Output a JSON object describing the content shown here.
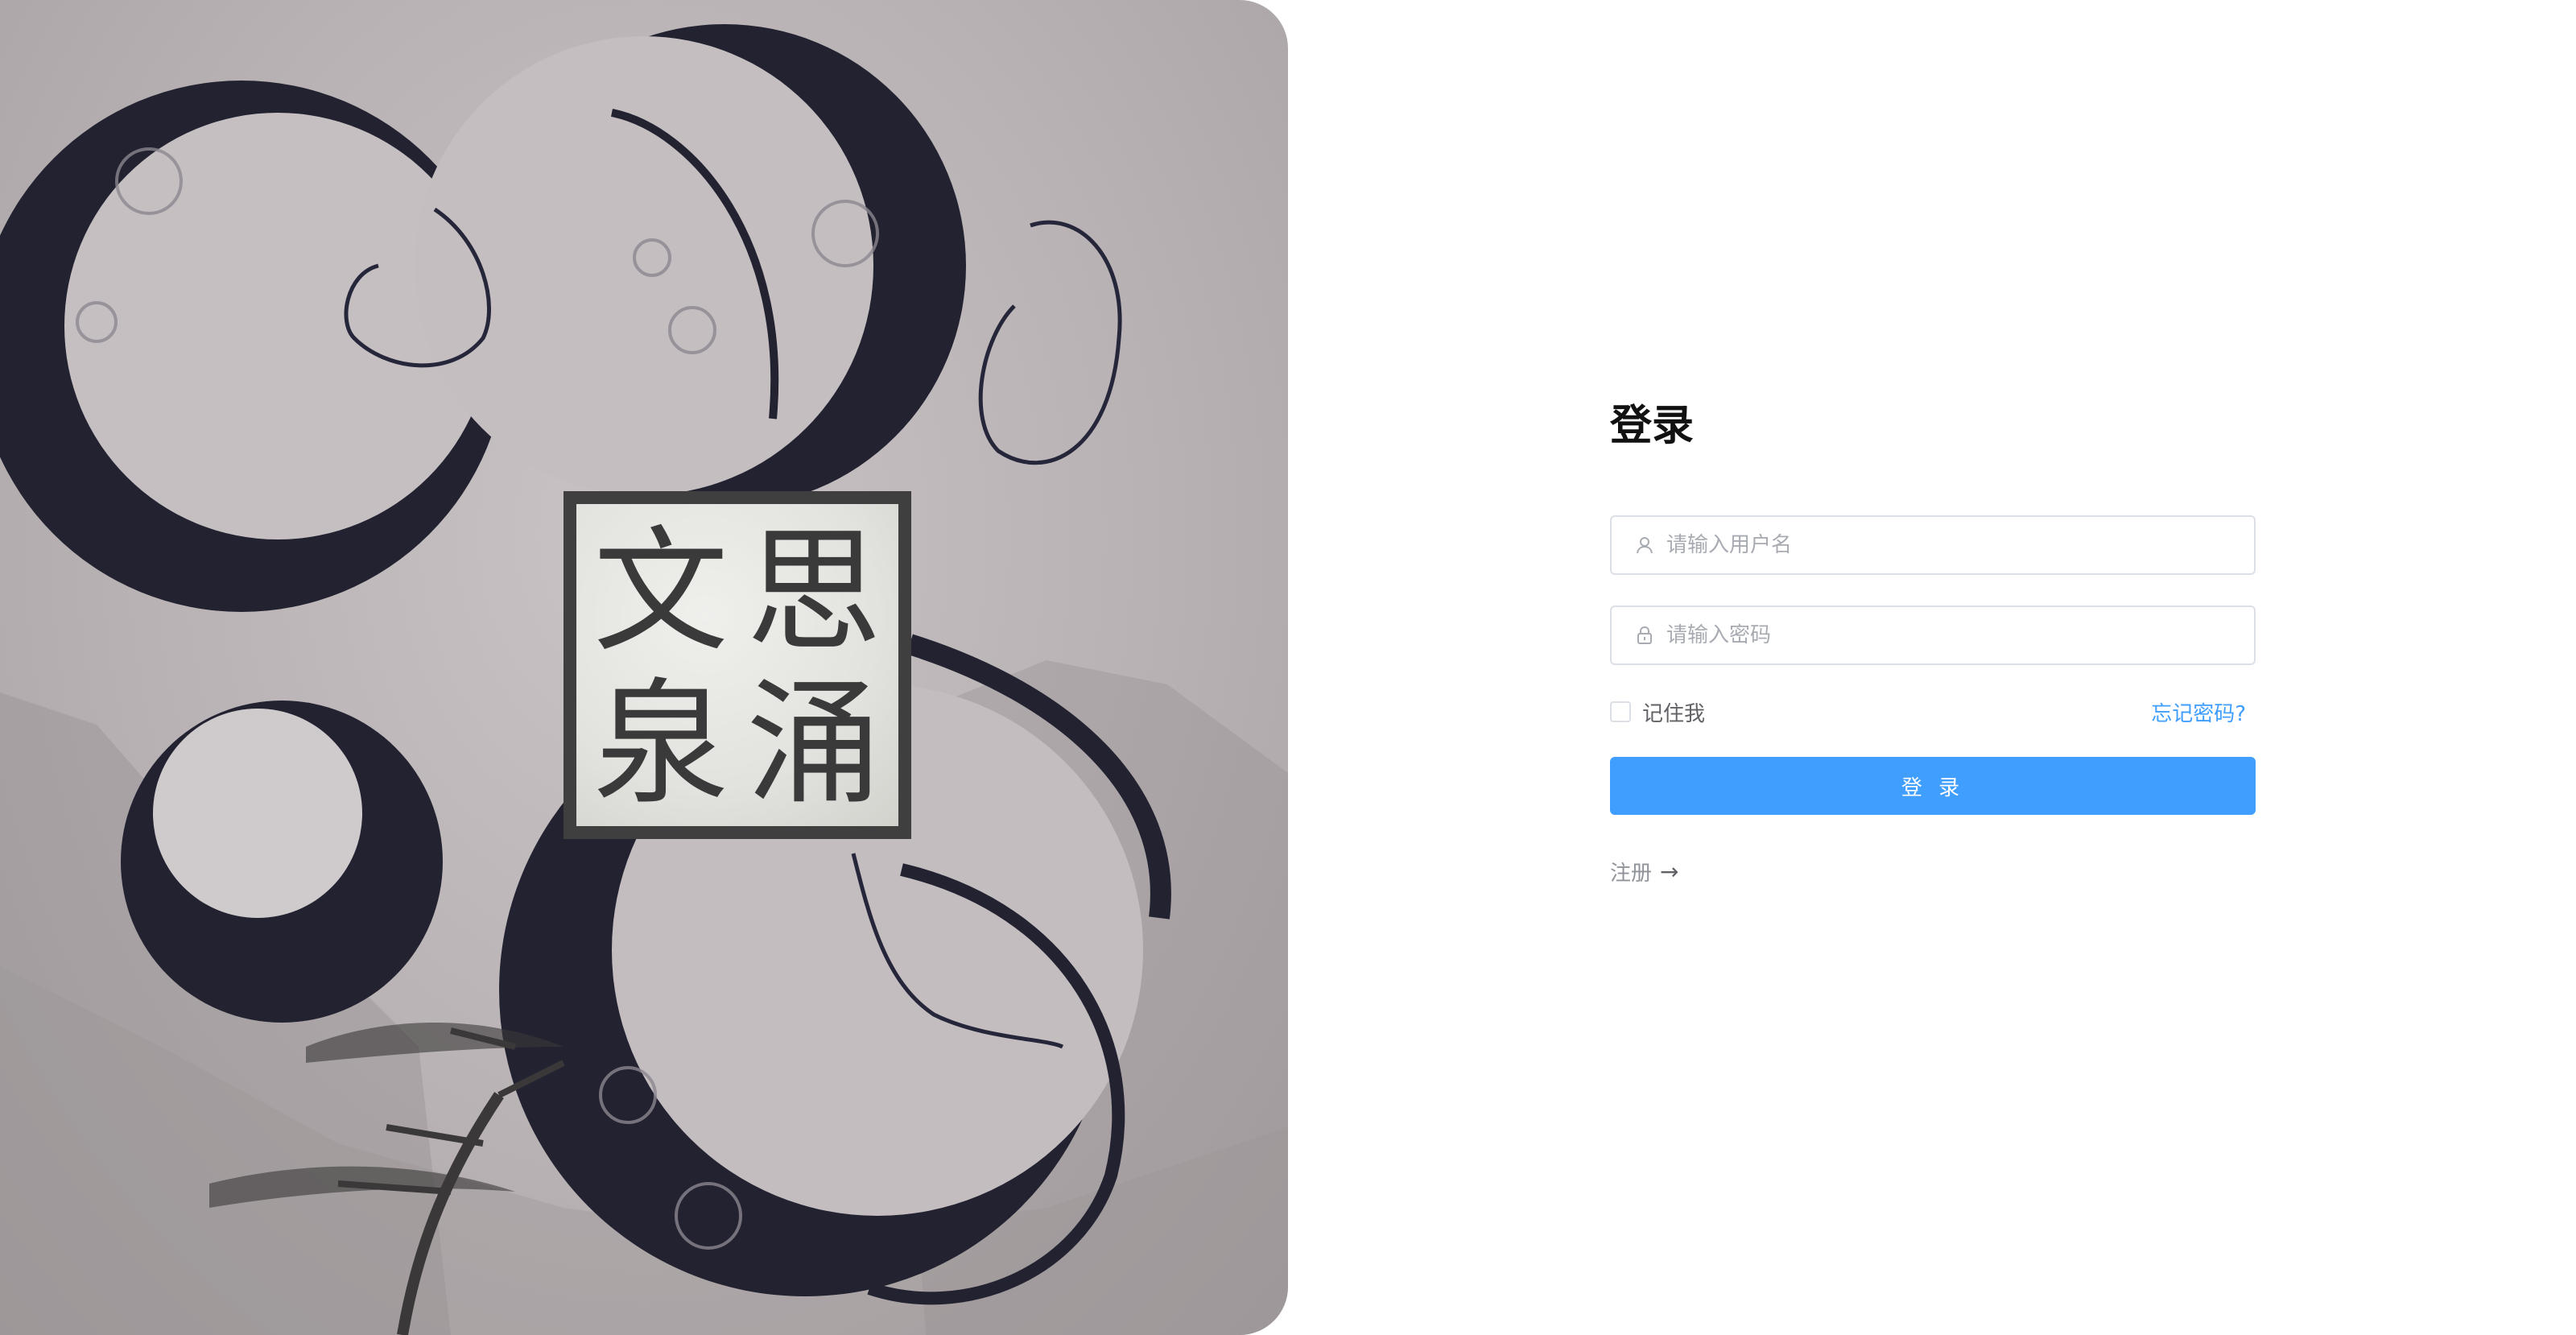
{
  "artwork": {
    "seal_chars": [
      "文",
      "思",
      "泉",
      "涌"
    ]
  },
  "login": {
    "title": "登录",
    "username_placeholder": "请输入用户名",
    "password_placeholder": "请输入密码",
    "remember_label": "记住我",
    "forgot_label": "忘记密码?",
    "submit_label": "登 录",
    "register_label": "注册",
    "register_arrow": "→"
  },
  "colors": {
    "primary": "#409eff",
    "ink": "#222231"
  },
  "icons": {
    "username": "user-icon",
    "password": "lock-icon"
  }
}
